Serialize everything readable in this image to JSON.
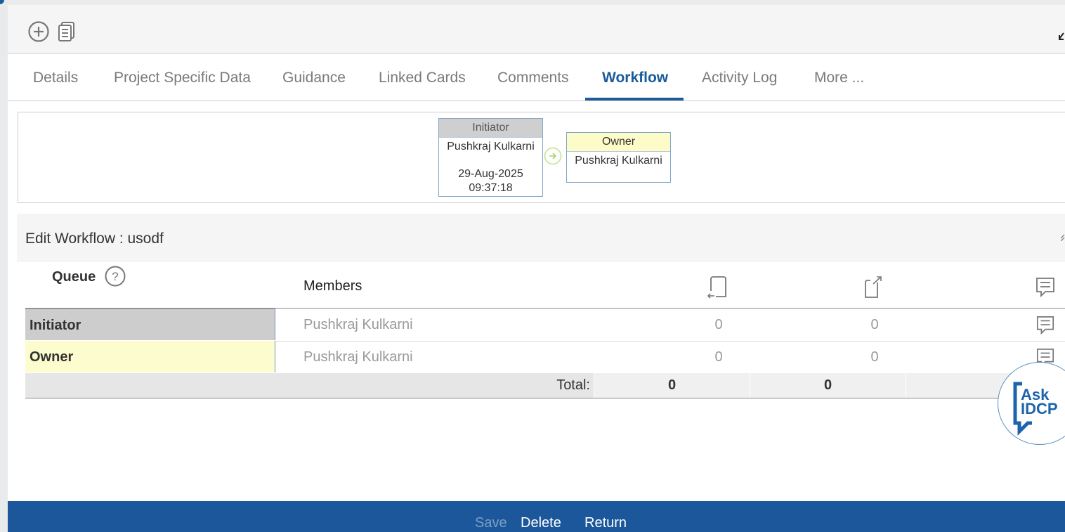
{
  "toolbar": {
    "icons": [
      "add-circle-icon",
      "copy-document-icon"
    ]
  },
  "tabs": [
    {
      "label": "Details",
      "active": false
    },
    {
      "label": "Project Specific Data",
      "active": false
    },
    {
      "label": "Guidance",
      "active": false
    },
    {
      "label": "Linked Cards",
      "active": false
    },
    {
      "label": "Comments",
      "active": false
    },
    {
      "label": "Workflow",
      "active": true
    },
    {
      "label": "Activity Log",
      "active": false
    },
    {
      "label": "More ...",
      "active": false
    }
  ],
  "workflow_diagram": {
    "initiator": {
      "title": "Initiator",
      "name": "Pushkraj Kulkarni",
      "date": "29-Aug-2025",
      "time": "09:37:18"
    },
    "owner": {
      "title": "Owner",
      "name": "Pushkraj Kulkarni"
    }
  },
  "edit_workflow": {
    "title": "Edit Workflow : usodf",
    "columns": {
      "queue": "Queue",
      "members": "Members"
    },
    "rows": [
      {
        "queue": "Initiator",
        "member": "Pushkraj Kulkarni",
        "received": "0",
        "sent": "0"
      },
      {
        "queue": "Owner",
        "member": "Pushkraj Kulkarni",
        "received": "0",
        "sent": "0"
      }
    ],
    "total": {
      "label": "Total:",
      "received": "0",
      "sent": "0"
    }
  },
  "ask_badge": {
    "line1": "Ask",
    "line2": "IDCP"
  },
  "footer": {
    "save": "Save",
    "delete": "Delete",
    "return": "Return"
  },
  "colors": {
    "brand": "#1b579a",
    "accent": "#1a5b9a",
    "initiator_bg": "#cdcdcd",
    "owner_bg": "#fdfcce"
  }
}
